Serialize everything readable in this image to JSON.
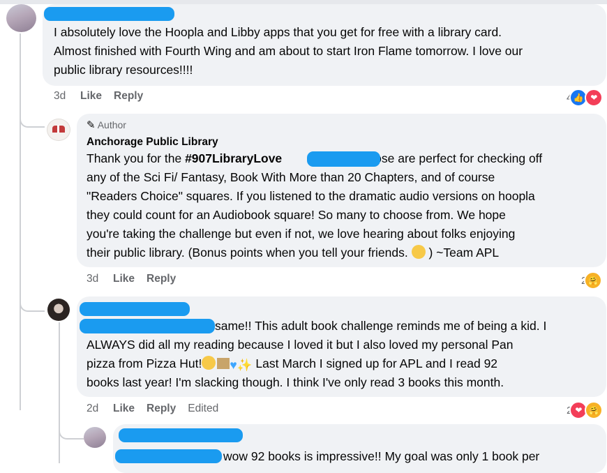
{
  "comment1": {
    "body_lines": [
      "I absolutely love the Hoopla and Libby apps that you get for free with a library card.",
      "Almost finished with Fourth Wing and am about to start Iron Flame tomorrow. I love our",
      "public library resources!!!!"
    ],
    "time": "3d",
    "like": "Like",
    "reply": "Reply",
    "reaction_count": "4"
  },
  "reply1": {
    "author_tag": "Author",
    "name": "Anchorage Public Library",
    "line1_pre": "Thank you for the ",
    "line1_hash": "#907LibraryLove",
    "line1_post": " Those are perfect for checking off",
    "lines": [
      "any of the Sci Fi/ Fantasy, Book With More than 20 Chapters, and of course",
      "\"Readers Choice\" squares. If you listened to the dramatic audio versions on hoopla",
      "they could count for an Audiobook square! So many to choose from. We hope",
      "you're taking the challenge but even if not, we love hearing about folks enjoying"
    ],
    "last_pre": "their public library. (Bonus points when you tell your friends. ",
    "last_post": " ) ~Team APL",
    "time": "3d",
    "like": "Like",
    "reply": "Reply",
    "reaction_count": "2"
  },
  "reply2": {
    "line1_post": "same!! This adult book challenge reminds me of being a kid. I",
    "line2": "ALWAYS did all my reading because I loved it but I also loved my personal Pan",
    "line3_pre": "pizza from Pizza Hut!",
    "line3_post": " Last March I signed up for APL and I read 92",
    "line4": "books last year! I'm slacking though. I think I've only read 3 books this month.",
    "time": "2d",
    "like": "Like",
    "reply": "Reply",
    "edited": "Edited",
    "reaction_count": "2"
  },
  "reply3": {
    "line1_post": "wow 92 books is impressive!! My goal was only 1 book per"
  },
  "colors": {
    "accent": "#1877f2",
    "redaction": "#1a9bf0",
    "bubble": "#f0f2f5",
    "muted": "#65676b"
  }
}
